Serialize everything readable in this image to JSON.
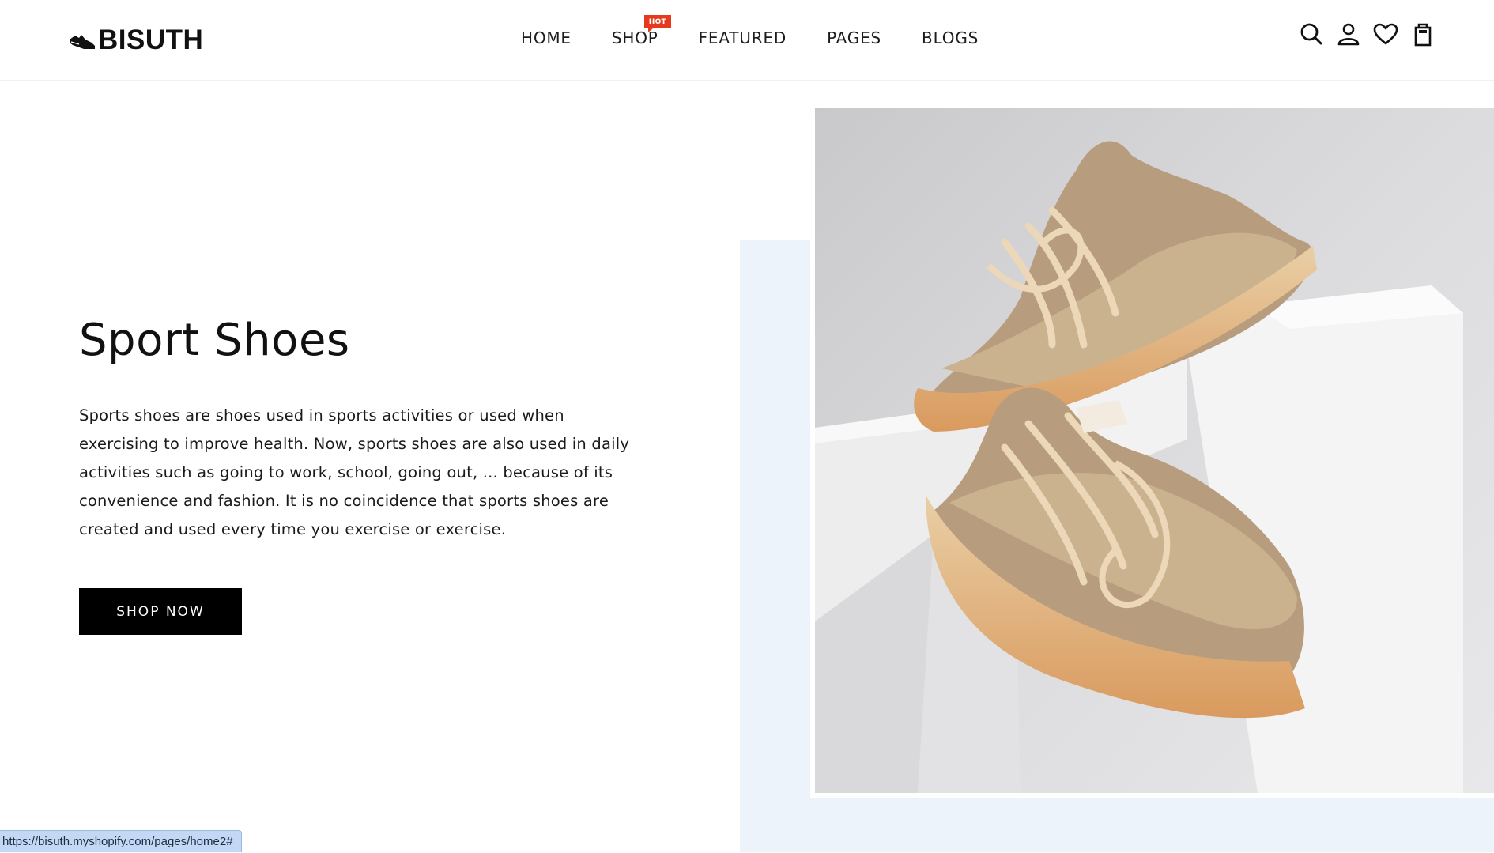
{
  "header": {
    "logo_text": "BISUTH",
    "nav": [
      {
        "label": "HOME"
      },
      {
        "label": "SHOP",
        "badge": "HOT"
      },
      {
        "label": "FEATURED"
      },
      {
        "label": "PAGES"
      },
      {
        "label": "BLOGS"
      }
    ],
    "icons": [
      "search-icon",
      "account-icon",
      "wishlist-heart-icon",
      "cart-bag-icon"
    ],
    "badge_color": "#e53a1e"
  },
  "hero": {
    "title": "Sport Shoes",
    "description": "Sports shoes are shoes used in sports activities or used when exercising to improve health. Now, sports shoes are also used in daily activities such as going to work, school, going out, ... because of its convenience and fashion. It is no coincidence that sports shoes are created and used every time you exercise or exercise.",
    "cta_label": "SHOP NOW",
    "accent_background": "#edf3fa"
  },
  "status_bar": {
    "url": "https://bisuth.myshopify.com/pages/home2#"
  }
}
